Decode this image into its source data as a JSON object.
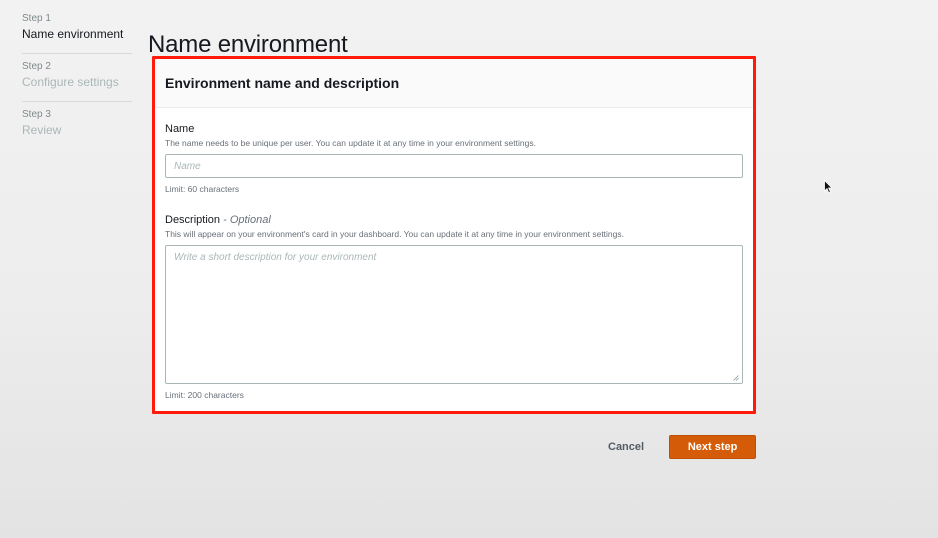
{
  "page_title": "Name environment",
  "steps": [
    {
      "number": "Step 1",
      "label": "Name environment",
      "active": true
    },
    {
      "number": "Step 2",
      "label": "Configure settings",
      "active": false
    },
    {
      "number": "Step 3",
      "label": "Review",
      "active": false
    }
  ],
  "card": {
    "title": "Environment name and description",
    "name_field": {
      "label": "Name",
      "description": "The name needs to be unique per user. You can update it at any time in your environment settings.",
      "placeholder": "Name",
      "value": "",
      "constraint": "Limit: 60 characters"
    },
    "description_field": {
      "label": "Description",
      "optional": "- Optional",
      "description": "This will appear on your environment's card in your dashboard. You can update it at any time in your environment settings.",
      "placeholder": "Write a short description for your environment",
      "value": "",
      "constraint": "Limit: 200 characters"
    }
  },
  "actions": {
    "cancel_label": "Cancel",
    "next_label": "Next step"
  },
  "colors": {
    "highlight": "#ff1a0a",
    "primary_button": "#d45b07",
    "text_primary": "#16191f",
    "text_secondary": "#687078"
  },
  "icons": {
    "resize_grip": "resize-grip-icon",
    "cursor": "mouse-cursor-icon"
  }
}
